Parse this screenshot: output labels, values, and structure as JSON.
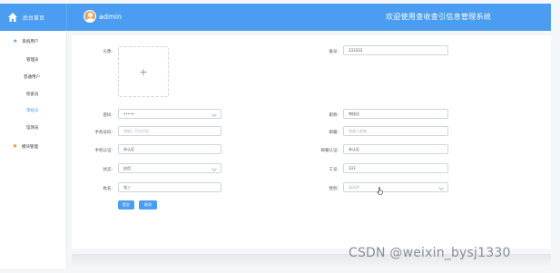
{
  "header": {
    "brand_label": "后台首页",
    "username": "admin",
    "title": "欢迎使用查收查引信息管理系统"
  },
  "sidebar": {
    "group_label": "系统用户",
    "items": [
      {
        "label": "管理员"
      },
      {
        "label": "普通用户"
      },
      {
        "label": "检索员"
      },
      {
        "label": "审核员"
      },
      {
        "label": "馆领员"
      }
    ],
    "module_label": "模块管理"
  },
  "form": {
    "avatar_label": "头像:",
    "upload_plus": "+",
    "account_label": "账号:",
    "account_value": "333333",
    "password_label": "密码:",
    "password_value": "•••••",
    "role_label": "职称:",
    "role_value": "审核员",
    "phone_label": "手机号码:",
    "phone_placeholder": "请输入手机号码",
    "email_label": "邮箱:",
    "email_placeholder": "请输入邮箱",
    "phone_verify_label": "手机认证:",
    "phone_verify_value": "未认证",
    "email_verify_label": "邮箱认证:",
    "email_verify_value": "未认证",
    "status_label": "状态:",
    "status_value": "启用",
    "workno_label": "工号:",
    "workno_value": "333",
    "name_label": "姓名:",
    "name_value": "张三",
    "gender_label": "性别:",
    "gender_placeholder": "请选择",
    "submit_label": "提交",
    "cancel_label": "取消"
  },
  "watermark": "CSDN @weixin_bysj1330",
  "colors": {
    "primary": "#4a9df0",
    "sidebar_bg": "#ffffff",
    "page_bg": "#f4f6f9"
  }
}
